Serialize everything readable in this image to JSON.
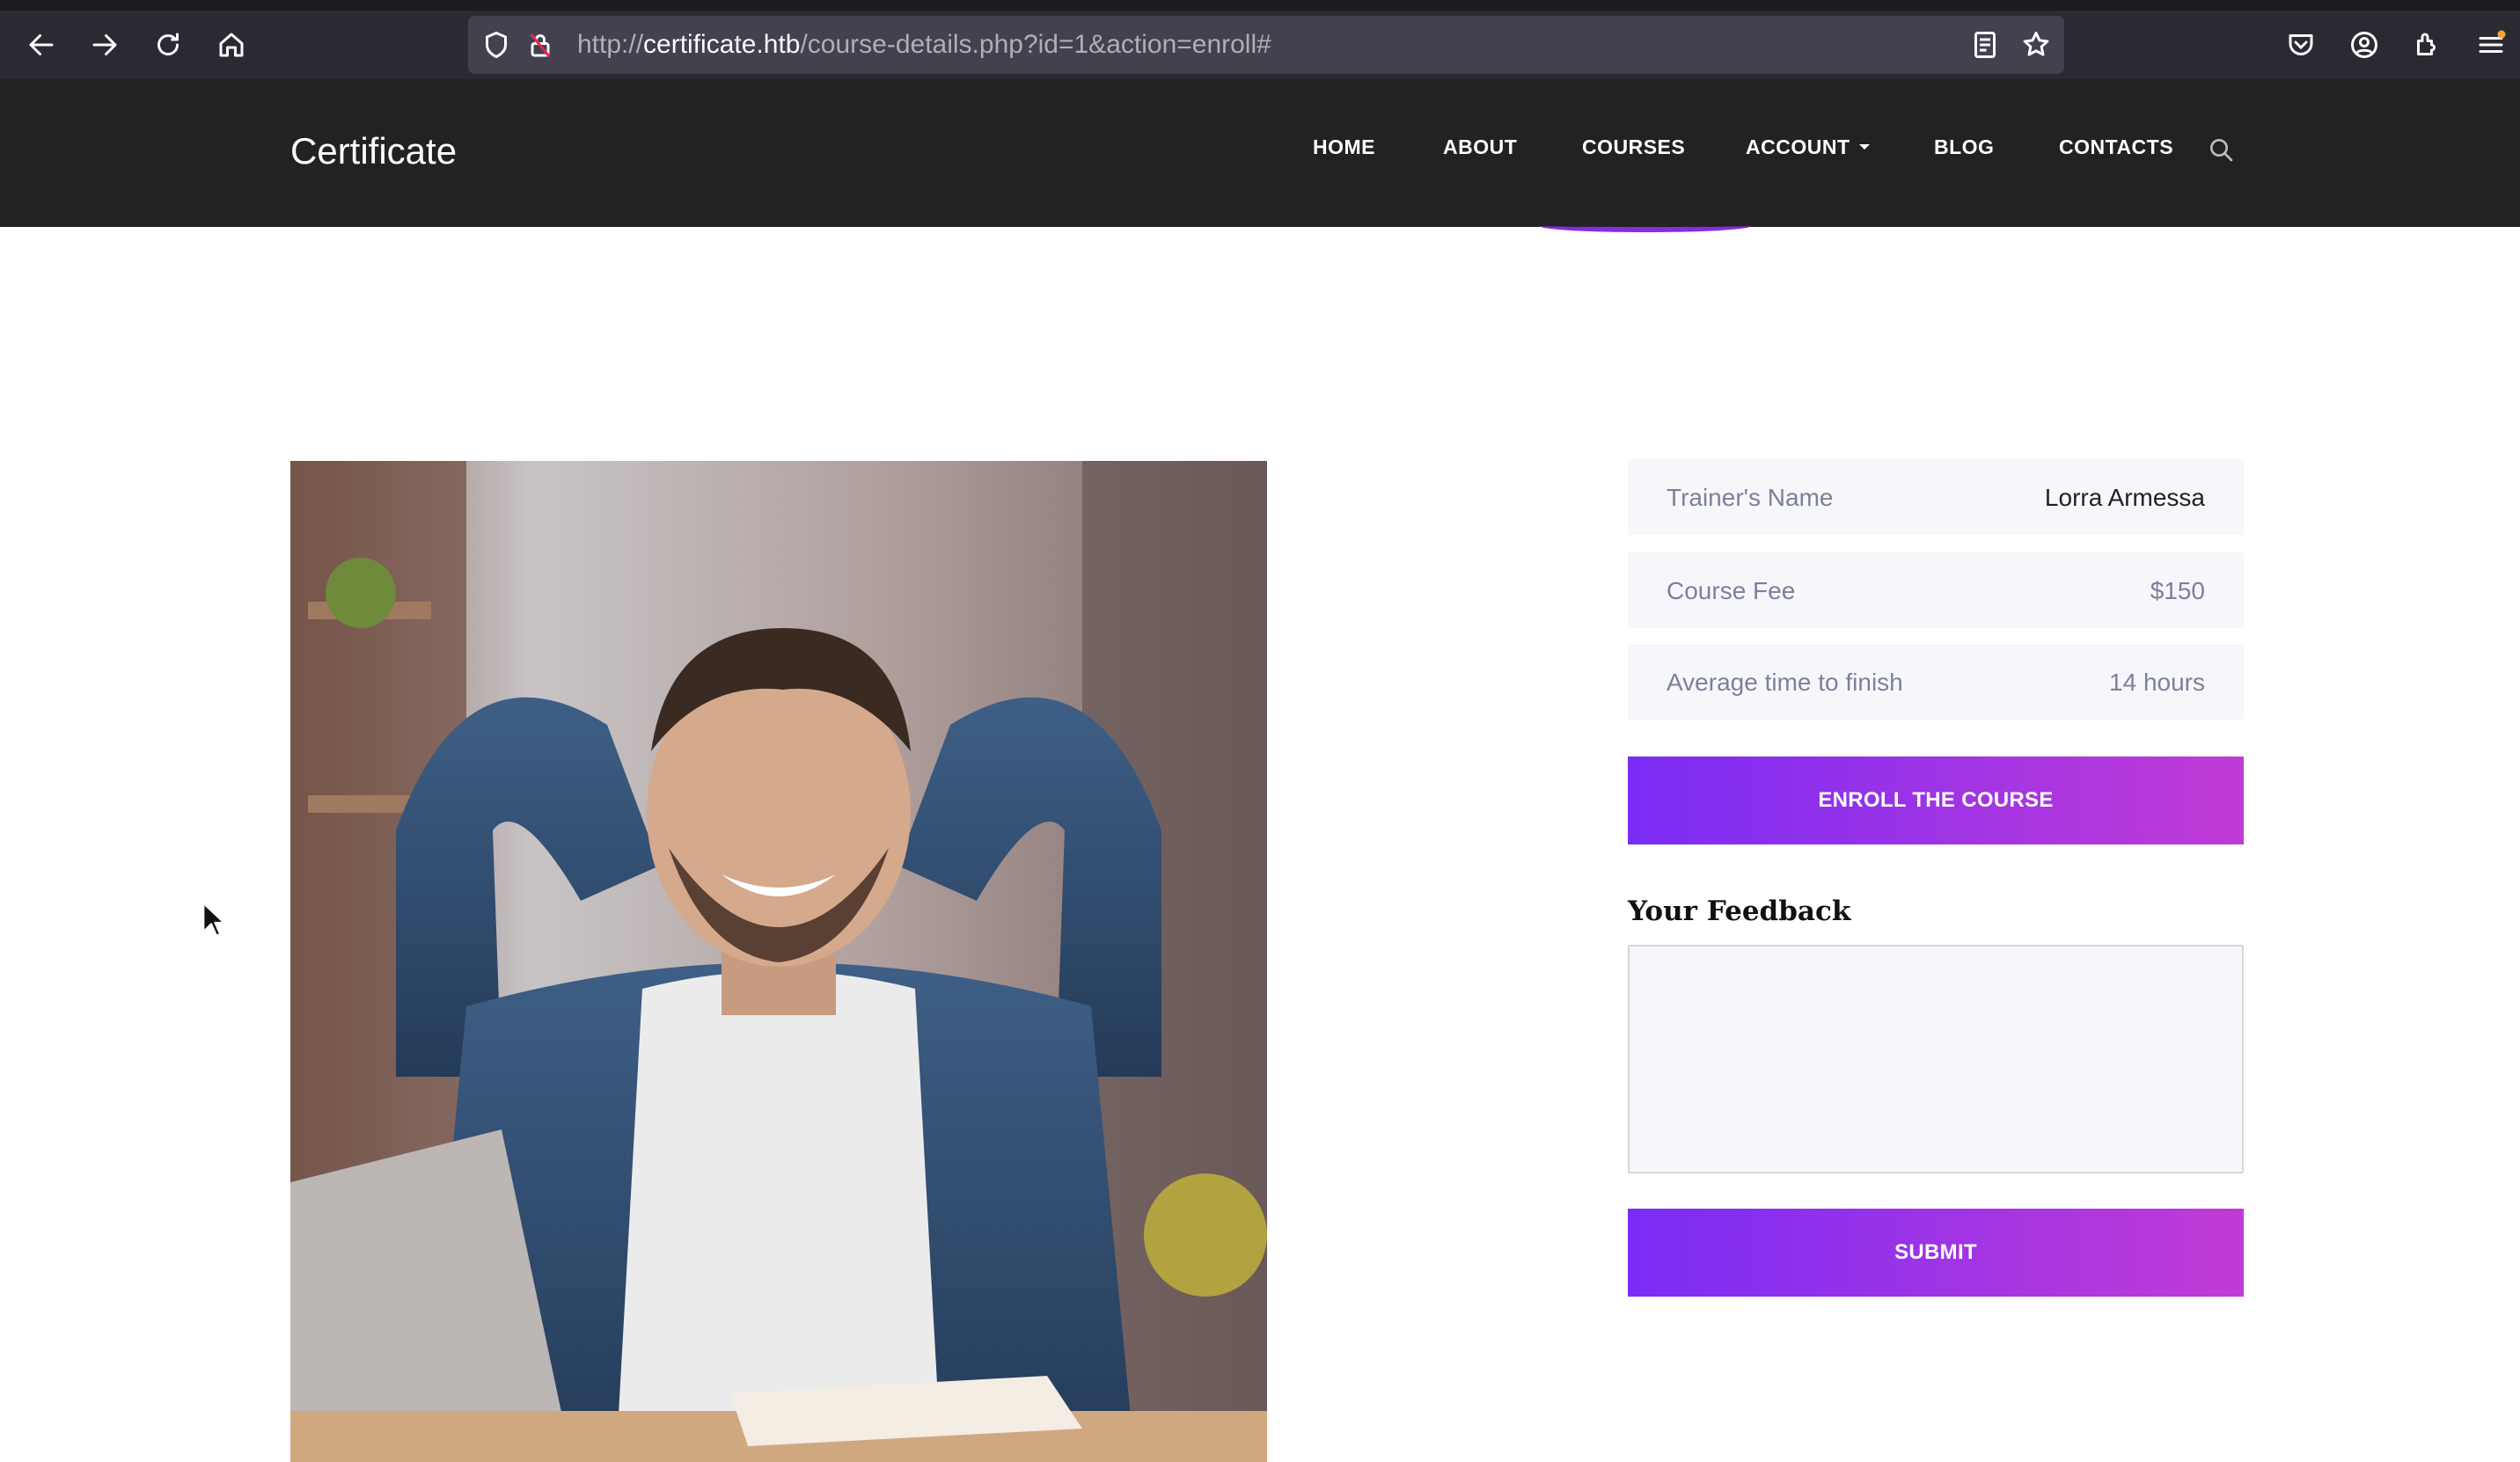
{
  "browser": {
    "url_scheme": "http://",
    "url_host": "certificate.htb",
    "url_path": "/course-details.php?id=1&action=enroll#",
    "icons": [
      "back-icon",
      "forward-icon",
      "reload-icon",
      "home-icon",
      "shield-icon",
      "insecure-lock-icon",
      "reader-view-icon",
      "bookmark-star-icon",
      "pocket-icon",
      "account-icon",
      "extensions-icon",
      "menu-icon"
    ]
  },
  "site": {
    "brand": "Certificate",
    "nav": {
      "home": "HOME",
      "about": "ABOUT",
      "courses": "COURSES",
      "account": "ACCOUNT",
      "blog": "BLOG",
      "contacts": "CONTACTS"
    }
  },
  "course": {
    "trainer_label": "Trainer's Name",
    "trainer_value": "Lorra Armessa",
    "fee_label": "Course Fee",
    "fee_value": "$150",
    "time_label": "Average time to finish",
    "time_value": "14 hours",
    "enroll_label": "ENROLL THE COURSE"
  },
  "feedback": {
    "title": "Your Feedback",
    "value": "",
    "submit_label": "SUBMIT"
  },
  "colors": {
    "header_bg": "#222222",
    "accent_start": "#7a2cf5",
    "accent_end": "#c13bd6"
  }
}
